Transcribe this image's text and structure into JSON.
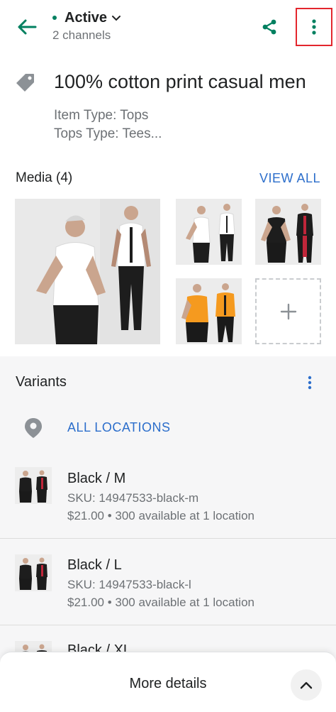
{
  "header": {
    "status": "Active",
    "channels": "2 channels"
  },
  "product": {
    "title": "100% cotton print casual men",
    "item_type": "Item Type: Tops",
    "tops_type": "Tops Type: Tees..."
  },
  "media": {
    "heading": "Media (4)",
    "view_all": "VIEW ALL",
    "images": [
      {
        "shirt": "#ffffff",
        "alt_shirt": "#ffffff",
        "pants": "#1c1c1c"
      },
      {
        "shirt": "#ffffff",
        "alt_shirt": "#ffffff",
        "pants": "#1c1c1c"
      },
      {
        "shirt": "#1d1d1d",
        "alt_shirt": "#1d1d1d",
        "pants": "#1c1c1c",
        "stripe": "#c0263a"
      },
      {
        "shirt": "#f59a1f",
        "alt_shirt": "#f59a1f",
        "pants": "#1c1c1c"
      }
    ]
  },
  "variants": {
    "title": "Variants",
    "locations_link": "ALL LOCATIONS",
    "items": [
      {
        "name": "Black / M",
        "sku": "SKU: 14947533-black-m",
        "info": "$21.00 • 300 available at 1 location"
      },
      {
        "name": "Black / L",
        "sku": "SKU: 14947533-black-l",
        "info": "$21.00 • 300 available at 1 location"
      },
      {
        "name": "Black / XL",
        "sku": "",
        "info": ""
      }
    ]
  },
  "footer": {
    "label": "More details"
  },
  "colors": {
    "accent_green": "#008060",
    "link_blue": "#2c6ecb",
    "highlight_red": "#e3262d"
  },
  "icons": [
    "back-arrow-icon",
    "chevron-down-icon",
    "share-icon",
    "more-vertical-icon",
    "tag-icon",
    "plus-icon",
    "location-pin-icon",
    "chevron-up-icon"
  ]
}
